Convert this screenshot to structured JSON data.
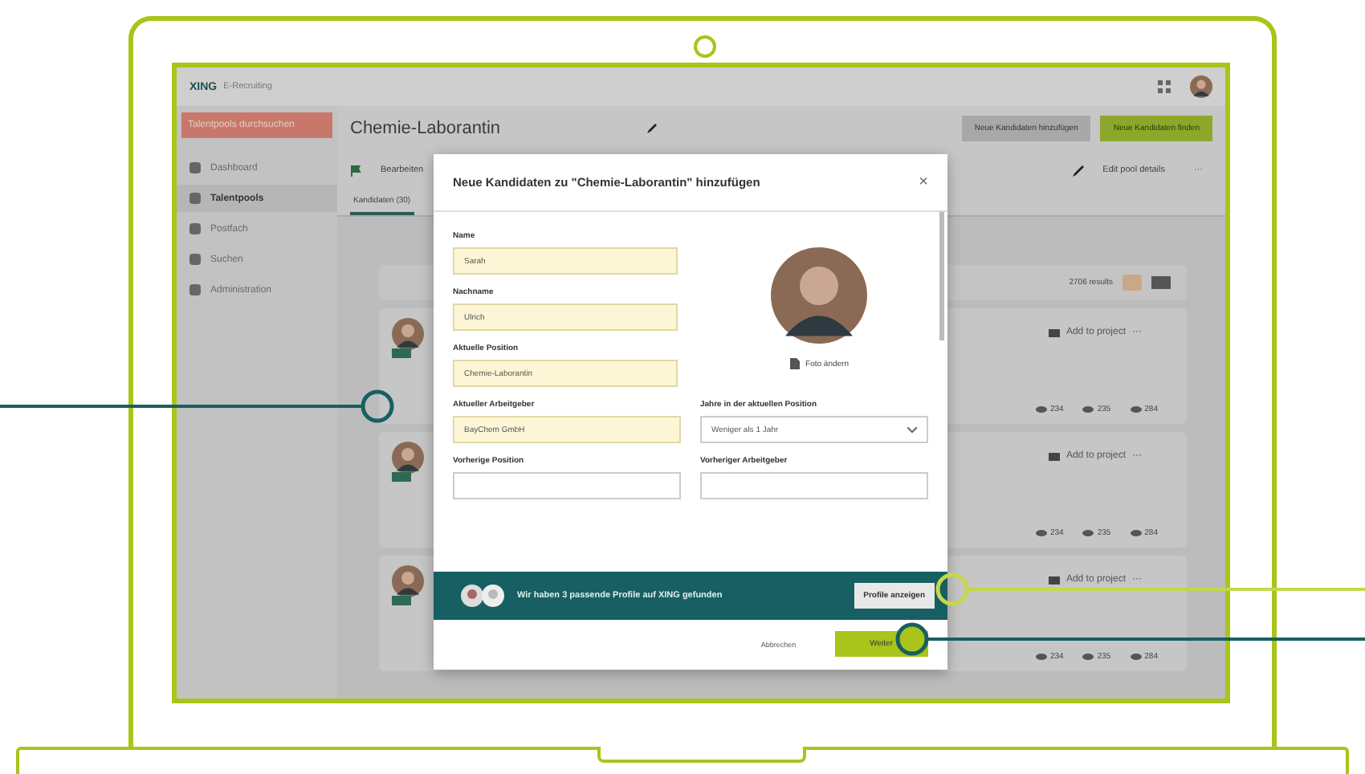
{
  "app": {
    "logo": "XING",
    "product": "E-Recruiting"
  },
  "sidebar": {
    "button": "Talentpools durchsuchen",
    "items": [
      {
        "label": "Dashboard",
        "selected": false
      },
      {
        "label": "Talentpools",
        "selected": true
      },
      {
        "label": "Postfach",
        "selected": false
      },
      {
        "label": "Suchen",
        "selected": false
      },
      {
        "label": "Administration",
        "selected": false
      }
    ]
  },
  "header": {
    "title": "Chemie-Laborantin",
    "buttons": [
      {
        "label": "Neue Kandidaten hinzufügen",
        "kind": "secondary"
      },
      {
        "label": "Neue Kandidaten finden",
        "kind": "primary"
      }
    ]
  },
  "toolbar": {
    "menu": "Bearbeiten",
    "edit": "Edit pool details",
    "more": "···"
  },
  "tabs": [
    {
      "label": "Kandidaten (30)",
      "selected": true
    }
  ],
  "results": {
    "count": "2706 results",
    "candidates": [
      {
        "action": "Add to project",
        "more": "···",
        "stats": [
          "234",
          "235",
          "284"
        ]
      },
      {
        "action": "Add to project",
        "more": "···",
        "stats": [
          "234",
          "235",
          "284"
        ]
      },
      {
        "action": "Add to project",
        "more": "···",
        "stats": [
          "234",
          "235",
          "284"
        ]
      }
    ]
  },
  "modal": {
    "title": "Neue Kandidaten zu \"Chemie-Laborantin\" hinzufügen",
    "close": "×",
    "fields": [
      {
        "label": "Name",
        "value": "Sarah",
        "filled": true
      },
      {
        "label": "Nachname",
        "value": "Ulrich",
        "filled": true
      },
      {
        "label": "Aktuelle Position",
        "value": "Chemie-Laborantin",
        "filled": true
      }
    ],
    "photo_action": "Foto ändern",
    "pairs": [
      [
        {
          "label": "Aktueller Arbeitgeber",
          "value": "BayChem GmbH",
          "kind": "input",
          "filled": true
        },
        {
          "label": "Jahre in der aktuellen Position",
          "value": "Weniger als 1 Jahr",
          "kind": "select",
          "filled": false
        }
      ],
      [
        {
          "label": "Vorherige Position",
          "kind": "input",
          "filled": false
        },
        {
          "label": "Vorheriger Arbeitgeber",
          "kind": "input",
          "filled": false
        }
      ]
    ],
    "banner": {
      "text": "Wir haben 3 passende Profile auf XING gefunden",
      "button": "Profile anzeigen"
    },
    "cancel": "Abbrechen",
    "submit": "Weiter"
  }
}
